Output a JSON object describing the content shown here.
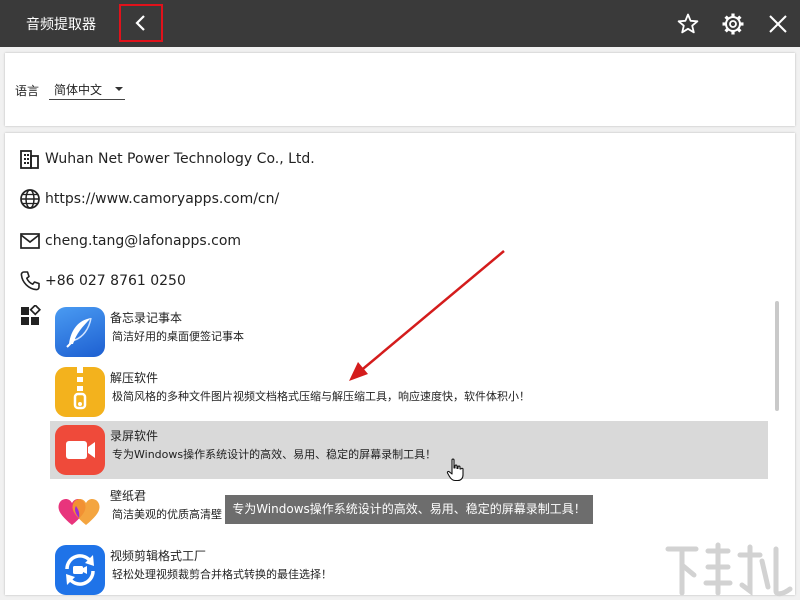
{
  "titlebar": {
    "title": "音频提取器",
    "icons": [
      "chevron-left-icon",
      "star-icon",
      "gear-icon",
      "close-icon"
    ]
  },
  "language": {
    "label": "语言",
    "selected": "简体中文"
  },
  "info": {
    "company": "Wuhan Net Power Technology Co., Ltd.",
    "website": "https://www.camoryapps.com/cn/",
    "email": "cheng.tang@lafonapps.com",
    "phone": "+86 027 8761 0250"
  },
  "apps": [
    {
      "name": "备忘录记事本",
      "desc": "简洁好用的桌面便签记事本",
      "icon": "feather-icon",
      "color": "#2f7de4"
    },
    {
      "name": "解压软件",
      "desc": "极简风格的多种文件图片视频文档格式压缩与解压缩工具，响应速度快，软件体积小！",
      "icon": "zipper-icon",
      "color": "#f3b21d"
    },
    {
      "name": "录屏软件",
      "desc": "专为Windows操作系统设计的高效、易用、稳定的屏幕录制工具！",
      "icon": "video-camera-icon",
      "color": "#ef4a3a"
    },
    {
      "name": "壁纸君",
      "desc": "简洁美观的优质高清壁",
      "icon": "hearts-icon",
      "color": "#e8347c"
    },
    {
      "name": "视频剪辑格式工厂",
      "desc": "轻松处理视频裁剪合并格式转换的最佳选择！",
      "icon": "refresh-video-icon",
      "color": "#1f73e8"
    }
  ],
  "tooltip": "专为Windows操作系统设计的高效、易用、稳定的屏幕录制工具！",
  "colors": {
    "titlebar": "#3a3a3a",
    "highlight_border": "#e0121b",
    "hover_row": "#d9d9d9",
    "tooltip_bg": "#6d6d6d",
    "arrow": "#d41c1c"
  }
}
